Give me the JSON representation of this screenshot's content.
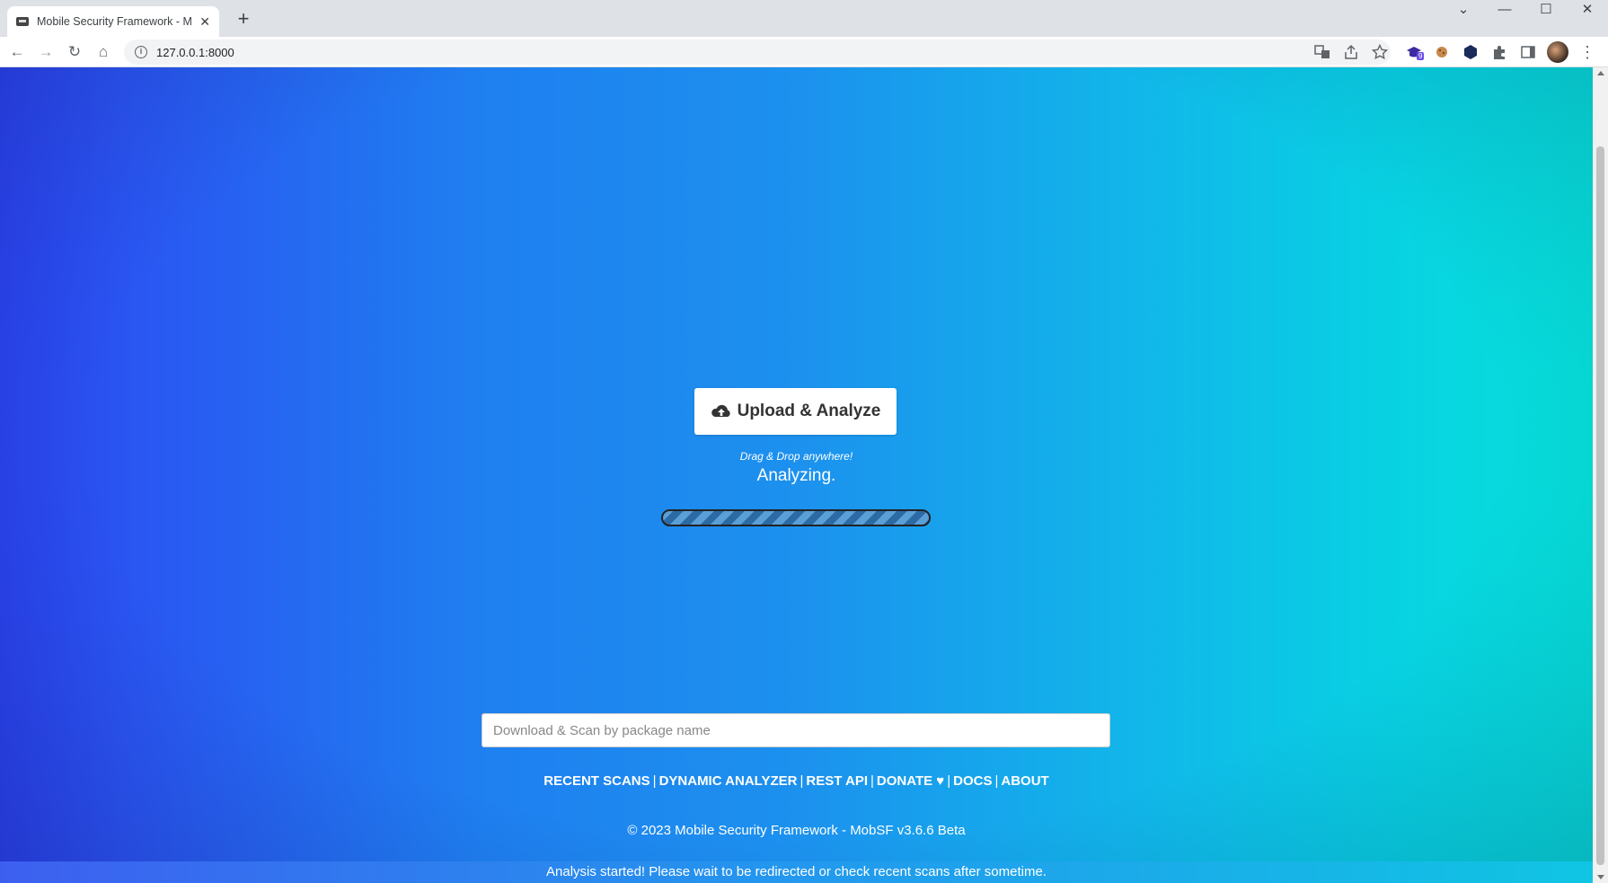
{
  "browser": {
    "tab_title": "Mobile Security Framework - MobSF",
    "url": "127.0.0.1:8000",
    "extension_badge": "9"
  },
  "page": {
    "upload_button": "Upload & Analyze",
    "drag_drop_hint": "Drag & Drop anywhere!",
    "status_text": "Analyzing.",
    "package_input_placeholder": "Download & Scan by package name",
    "links": [
      {
        "label": "RECENT SCANS"
      },
      {
        "label": "DYNAMIC ANALYZER"
      },
      {
        "label": "REST API"
      },
      {
        "label": "DONATE ♥"
      },
      {
        "label": "DOCS"
      },
      {
        "label": "ABOUT"
      }
    ],
    "footer": "© 2023 Mobile Security Framework - MobSF v3.6.6 Beta",
    "notification": "Analysis started! Please wait to be redirected or check recent scans after sometime."
  },
  "colors": {
    "gradient_left": "#2a43ec",
    "gradient_right": "#06e0d9"
  }
}
